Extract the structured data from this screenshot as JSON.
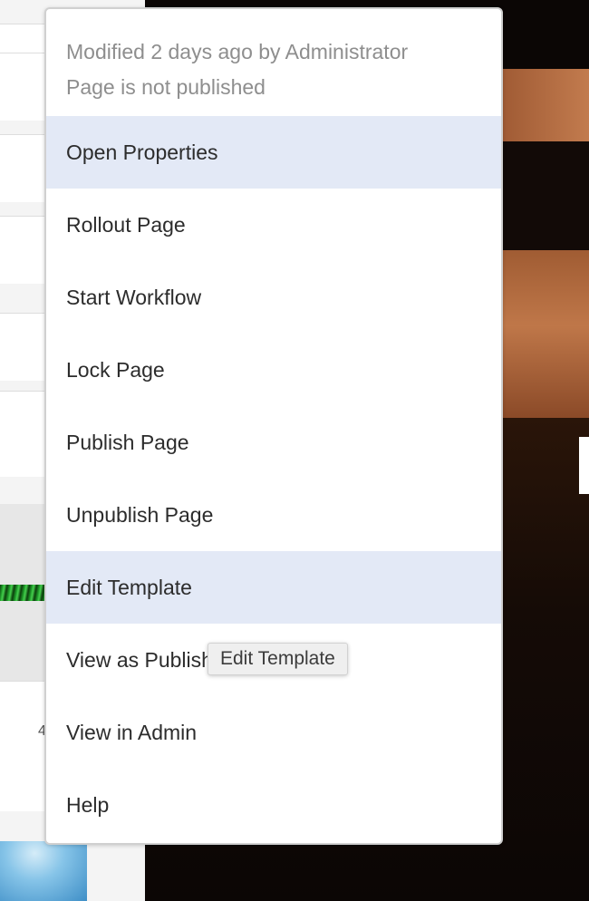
{
  "menu": {
    "meta_modified": "Modified 2 days ago by Administrator",
    "meta_status": "Page is not published",
    "items": [
      {
        "label": "Open Properties",
        "highlighted": true
      },
      {
        "label": "Rollout Page",
        "highlighted": false
      },
      {
        "label": "Start Workflow",
        "highlighted": false
      },
      {
        "label": "Lock Page",
        "highlighted": false
      },
      {
        "label": "Publish Page",
        "highlighted": false
      },
      {
        "label": "Unpublish Page",
        "highlighted": false
      },
      {
        "label": "Edit Template",
        "highlighted": true
      },
      {
        "label": "View as Publish",
        "highlighted": false
      },
      {
        "label": "View in Admin",
        "highlighted": false
      },
      {
        "label": "Help",
        "highlighted": false
      }
    ]
  },
  "tooltip": {
    "text": "Edit Template"
  },
  "background": {
    "left_panel_partial_char": "4"
  },
  "colors": {
    "highlight": "#e3e9f6",
    "menu_text": "#2c2c2c",
    "meta_text": "#8e8e8e"
  }
}
